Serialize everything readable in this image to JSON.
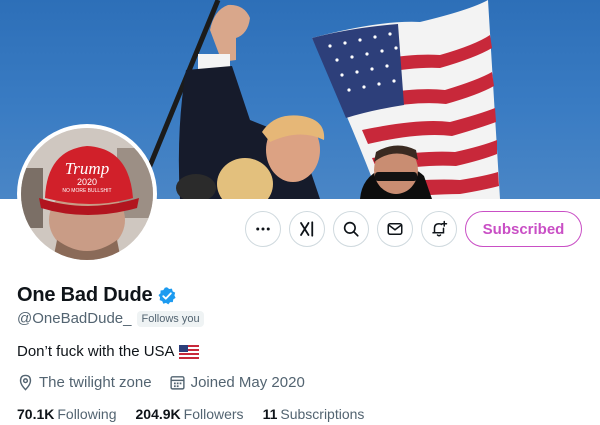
{
  "profile": {
    "display_name": "One Bad Dude",
    "handle": "@OneBadDude_",
    "follows_you": "Follows you",
    "bio_text": "Don’t fuck with the USA",
    "location": "The twilight zone",
    "joined": "Joined May 2020",
    "verified_color": "#1d9bf0"
  },
  "avatar": {
    "hat_line1": "Trump",
    "hat_line2": "2020",
    "hat_line3": "NO MORE BULLSHIT"
  },
  "actions": {
    "more_icon": "more-icon",
    "grok_icon": "grok-icon",
    "search_icon": "search-icon",
    "message_icon": "message-icon",
    "notify_icon": "bell-plus-icon",
    "subscribed_label": "Subscribed",
    "accent_color": "#c94fc5"
  },
  "stats": {
    "following_count": "70.1K",
    "following_label": "Following",
    "followers_count": "204.9K",
    "followers_label": "Followers",
    "subscriptions_count": "11",
    "subscriptions_label": "Subscriptions"
  }
}
